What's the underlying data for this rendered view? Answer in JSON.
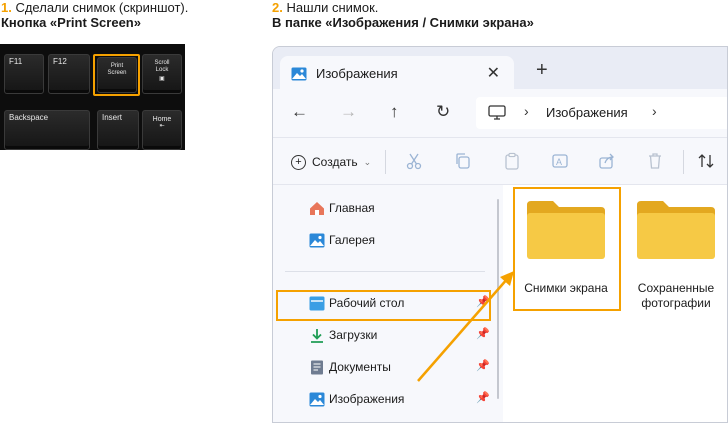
{
  "step1": {
    "number": "1.",
    "text": " Сделали снимок (скриншот).",
    "title": "Кнопка «Print Screen»"
  },
  "step2": {
    "number": "2.",
    "text": " Нашли снимок.",
    "title": "В папке «Изображения / Снимки экрана»"
  },
  "keyboard": {
    "keys": {
      "f11": "F11",
      "f12": "F12",
      "print_screen_1": "Print",
      "print_screen_2": "Screen",
      "scroll_lock_1": "Scroll",
      "scroll_lock_2": "Lock",
      "backspace": "Backspace",
      "insert": "Insert",
      "home": "Home"
    }
  },
  "explorer": {
    "tab_title": "Изображения",
    "tab_close": "✕",
    "new_tab": "+",
    "nav": {
      "back": "←",
      "forward": "→",
      "up": "↑",
      "refresh": "↻"
    },
    "address": {
      "separator": "›",
      "crumb": "Изображения"
    },
    "toolbar": {
      "create_label": "Создать",
      "create_chevron": "⌄"
    },
    "sidebar": {
      "home": "Главная",
      "gallery": "Галерея",
      "desktop": "Рабочий стол",
      "downloads": "Загрузки",
      "documents": "Документы",
      "pictures": "Изображения",
      "pin": "📌"
    },
    "folders": [
      {
        "name": "Снимки экрана"
      },
      {
        "name_line1": "Сохраненные",
        "name_line2": "фотографии"
      }
    ]
  },
  "colors": {
    "accent": "#f5a100",
    "folder": "#f6c945",
    "folder_dark": "#e3a820",
    "window_bg": "#eef0f8"
  }
}
